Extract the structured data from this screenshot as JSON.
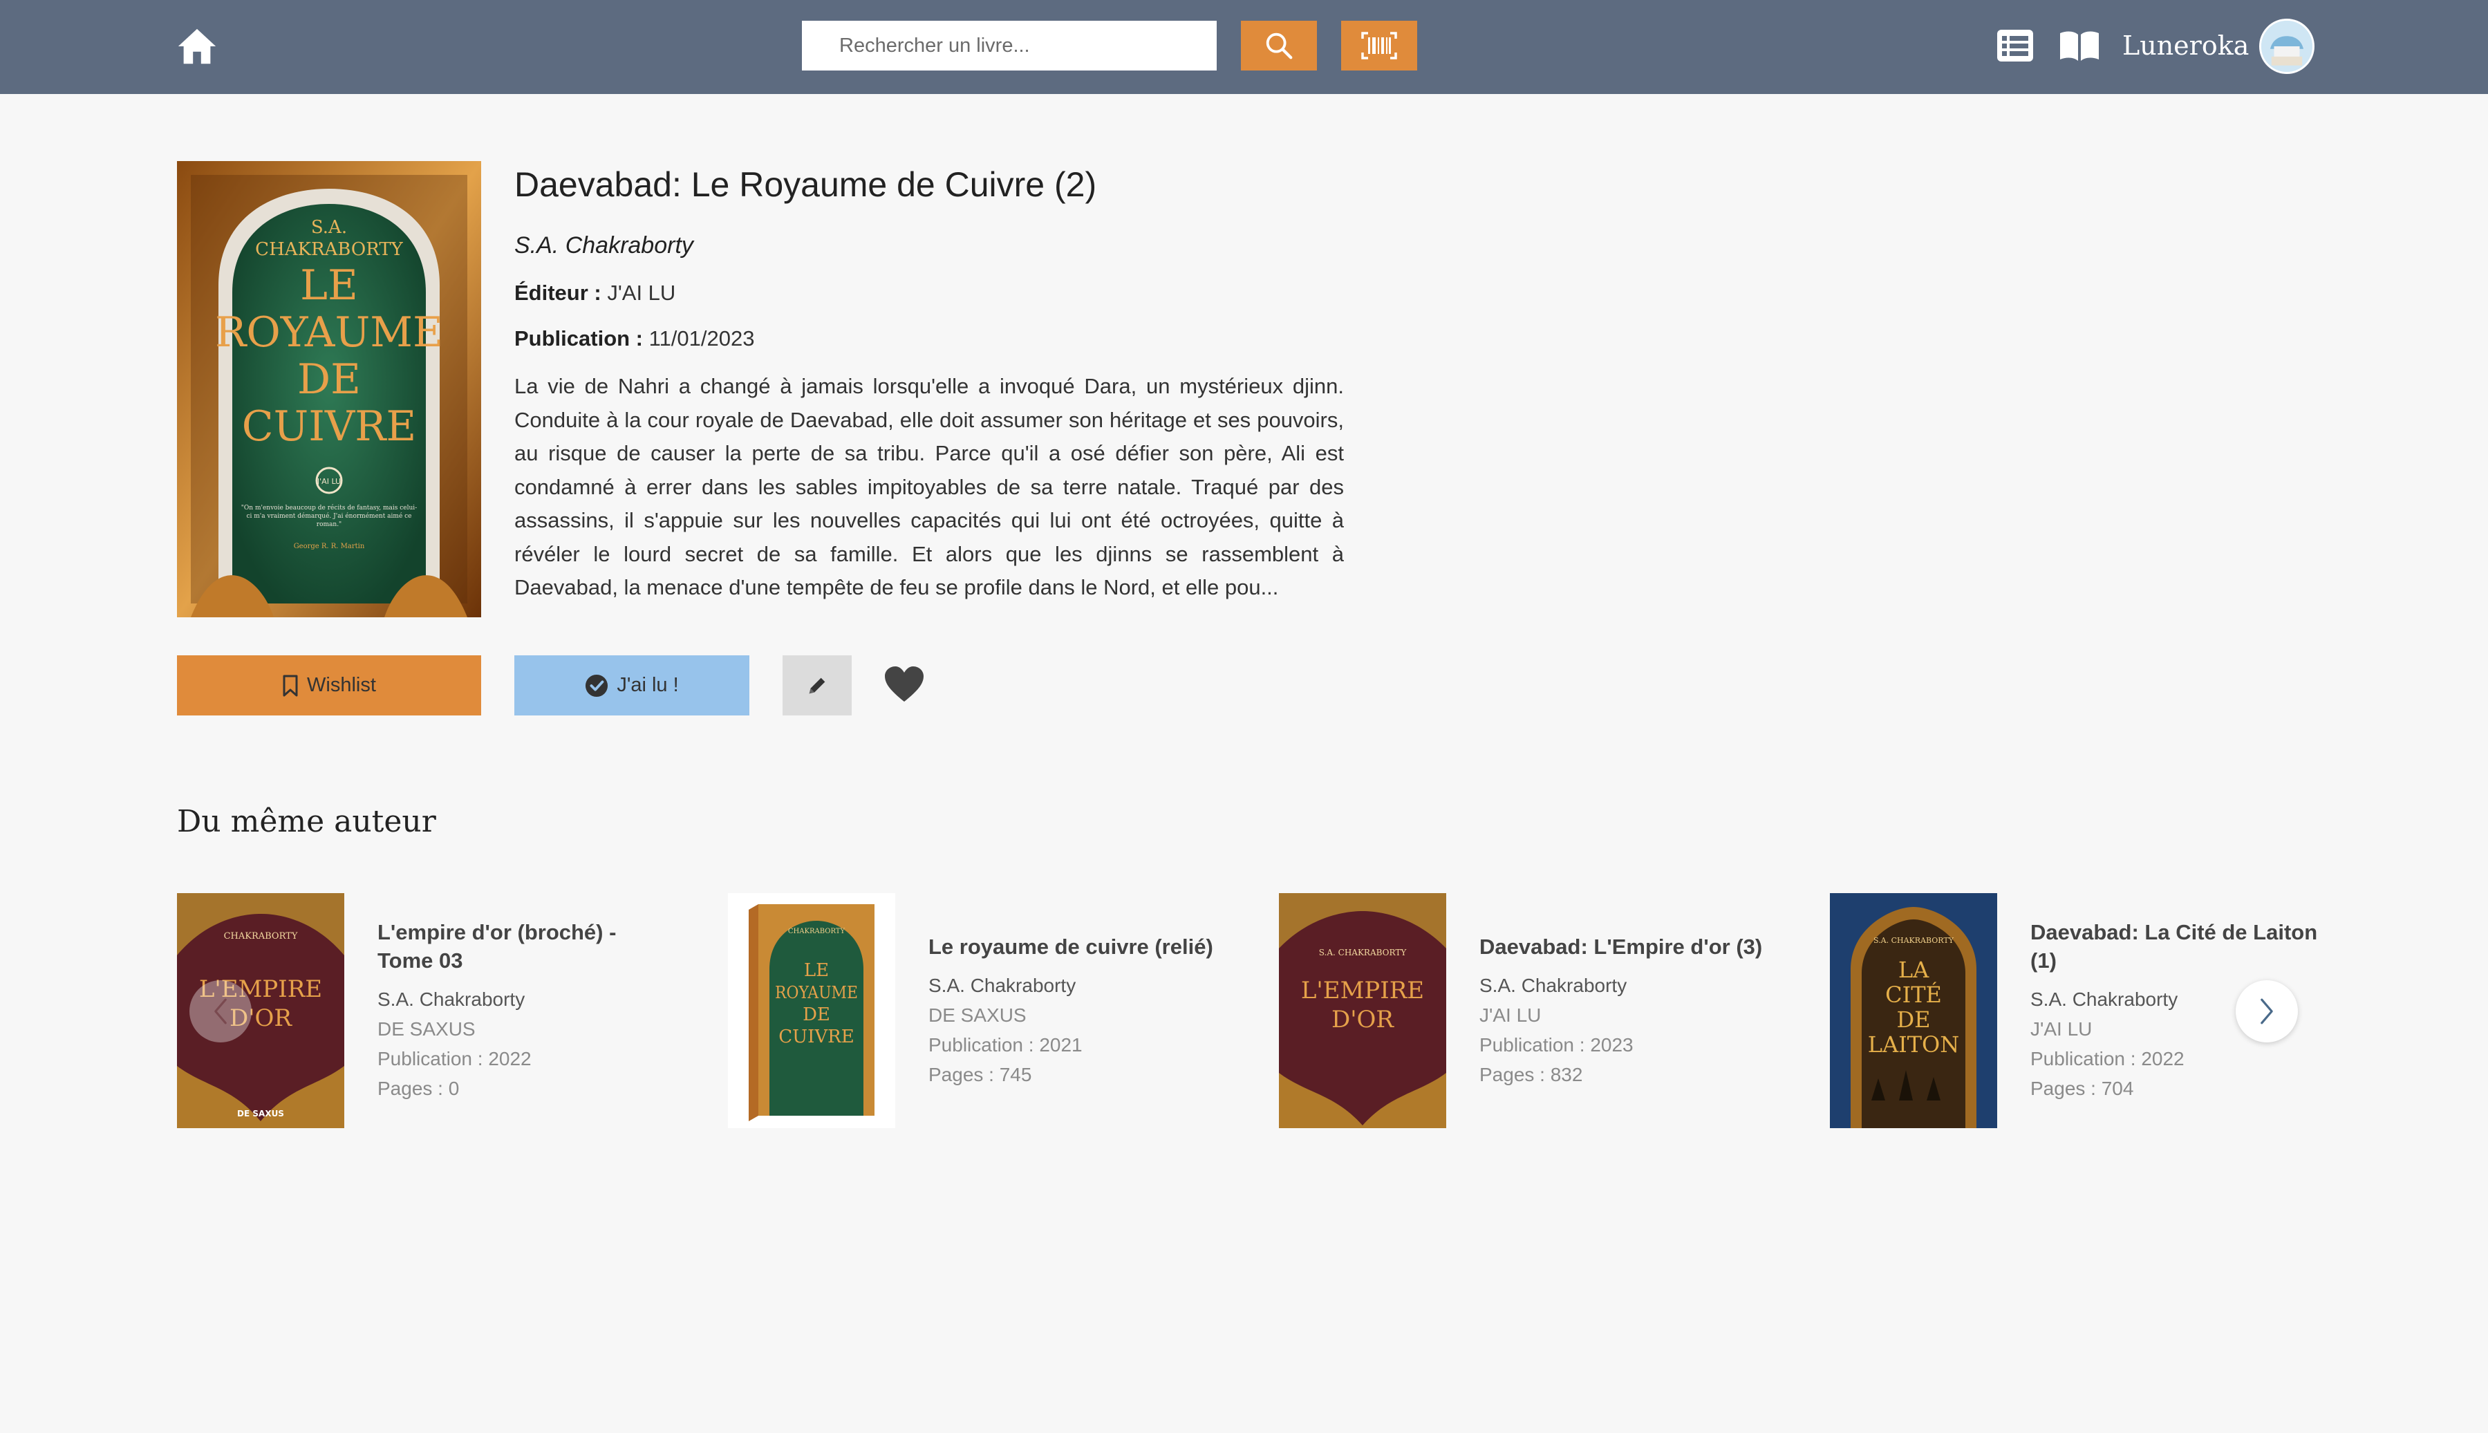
{
  "header": {
    "search_placeholder": "Rechercher un livre...",
    "username": "Luneroka",
    "icons": [
      "home-icon",
      "search-icon",
      "barcode-icon",
      "list-icon",
      "book-open-icon"
    ],
    "accent_color": "#e08b3b",
    "bar_color": "#5d6b80"
  },
  "book": {
    "title": "Daevabad: Le Royaume de Cuivre (2)",
    "author": "S.A. Chakraborty",
    "editor_label": "Éditeur :",
    "editor": "J'AI LU",
    "publication_label": "Publication :",
    "publication": "11/01/2023",
    "synopsis": "La vie de Nahri a changé à jamais lorsqu'elle a invoqué Dara, un mystérieux djinn. Conduite à la cour royale de Daevabad, elle doit assumer son héritage et ses pouvoirs, au risque de causer la perte de sa tribu. Parce qu'il a osé défier son père, Ali est condamné à errer dans les sables impitoyables de sa terre natale. Traqué par des assassins, il s'appuie sur les nouvelles capacités qui lui ont été octroyées, quitte à révéler le lourd secret de sa famille. Et alors que les djinns se rassemblent à Daevabad, la menace d'une tempête de feu se profile dans le Nord, et elle pou...",
    "cover": {
      "author_line1": "S.A.",
      "author_line2": "CHAKRABORTY",
      "title_lines": [
        "LE",
        "ROYAUME",
        "DE",
        "CUIVRE"
      ],
      "publisher_mark": "J'AI LU",
      "quote": "\"On m'envoie beaucoup de récits de fantasy, mais celui-ci m'a vraiment démarqué. J'ai énormément aimé ce roman.\"",
      "quote_author": "George R. R. Martin"
    }
  },
  "actions": {
    "wishlist_label": "Wishlist",
    "read_label": "J'ai lu !"
  },
  "same_author": {
    "title": "Du même auteur",
    "books": [
      {
        "title": "L'empire d'or (broché) - Tome 03",
        "author": "S.A. Chakraborty",
        "publisher": "DE SAXUS",
        "publication": "Publication : 2022",
        "pages": "Pages : 0",
        "cover_top": "CHAKRABORTY",
        "cover_lines": [
          "L'EMPIRE",
          "D'OR"
        ],
        "cover_bottom": "DE SAXUS"
      },
      {
        "title": "Le royaume de cuivre (relié)",
        "author": "S.A. Chakraborty",
        "publisher": "DE SAXUS",
        "publication": "Publication : 2021",
        "pages": "Pages : 745",
        "cover_top": "CHAKRABORTY",
        "cover_lines": [
          "LE",
          "ROYAUME",
          "DE",
          "CUIVRE"
        ],
        "cover_bottom": ""
      },
      {
        "title": "Daevabad: L'Empire d'or (3)",
        "author": "S.A. Chakraborty",
        "publisher": "J'AI LU",
        "publication": "Publication : 2023",
        "pages": "Pages : 832",
        "cover_top": "S.A. CHAKRABORTY",
        "cover_lines": [
          "L'EMPIRE",
          "D'OR"
        ],
        "cover_bottom": ""
      },
      {
        "title": "Daevabad: La Cité de Laiton (1)",
        "author": "S.A. Chakraborty",
        "publisher": "J'AI LU",
        "publication": "Publication : 2022",
        "pages": "Pages : 704",
        "cover_top": "S.A. CHAKRABORTY",
        "cover_lines": [
          "LA",
          "CITÉ",
          "DE",
          "LAITON"
        ],
        "cover_bottom": ""
      }
    ]
  }
}
